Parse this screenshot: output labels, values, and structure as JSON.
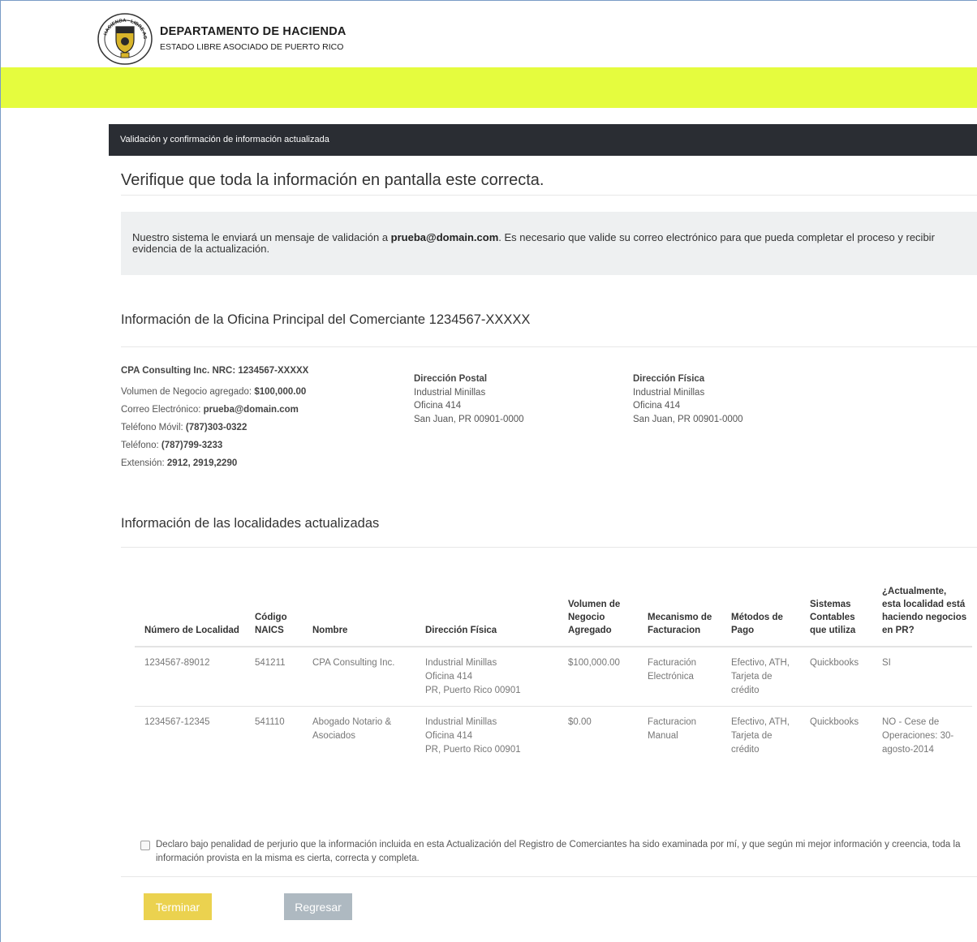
{
  "header": {
    "agency": "DEPARTAMENTO DE HACIENDA",
    "subtitle": "ESTADO LIBRE ASOCIADO DE PUERTO RICO",
    "seal_text": "HACIENDA · LIBRE ASOCIADO DE PUERTO RICO · 1952"
  },
  "section_bar": "Validación y confirmación de información actualizada",
  "page_heading": "Verifique que toda la información en pantalla este correcta.",
  "notice": {
    "before": "Nuestro sistema le enviará un mensaje de validación a ",
    "email": "prueba@domain.com",
    "after": ". Es necesario que valide su correo electrónico para que pueda completar el proceso y recibir evidencia de la actualización."
  },
  "office": {
    "heading": "Información de la Oficina Principal del Comerciante 1234567-XXXXX",
    "company_line": "CPA Consulting Inc. NRC: 1234567-XXXXX",
    "fields": [
      {
        "label": "Volumen de Negocio agregado: ",
        "value": "$100,000.00"
      },
      {
        "label": "Correo Electrónico: ",
        "value": "prueba@domain.com"
      },
      {
        "label": "Teléfono Móvil: ",
        "value": "(787)303-0322"
      },
      {
        "label": "Teléfono: ",
        "value": "(787)799-3233"
      },
      {
        "label": "Extensión: ",
        "value": "2912, 2919,2290"
      }
    ],
    "postal": {
      "title": "Dirección Postal",
      "line1": "Industrial Minillas",
      "line2": "Oficina 414",
      "line3": "San Juan, PR 00901-0000"
    },
    "physical": {
      "title": "Dirección Física",
      "line1": "Industrial Minillas",
      "line2": "Oficina 414",
      "line3": "San Juan, PR 00901-0000"
    }
  },
  "locations": {
    "heading": "Información de las localidades actualizadas",
    "columns": [
      "Número de Localidad",
      "Código NAICS",
      "Nombre",
      "Dirección Física",
      "Volumen de Negocio Agregado",
      "Mecanismo de Facturacion",
      "Métodos de Pago",
      "Sistemas Contables que utiliza",
      "¿Actualmente, esta localidad está haciendo negocios en PR?"
    ],
    "rows": [
      {
        "numero": "1234567-89012",
        "naics": "541211",
        "nombre": "CPA Consulting Inc.",
        "dir1": "Industrial Minillas",
        "dir2": "Oficina 414",
        "dir3": "PR, Puerto Rico 00901",
        "volumen": "$100,000.00",
        "mecanismo": "Facturación Electrónica",
        "pago": "Efectivo, ATH, Tarjeta de crédito",
        "sistemas": "Quickbooks",
        "activo": "SI"
      },
      {
        "numero": "1234567-12345",
        "naics": "541110",
        "nombre": "Abogado Notario & Asociados",
        "dir1": "Industrial Minillas",
        "dir2": "Oficina 414",
        "dir3": "PR, Puerto Rico 00901",
        "volumen": "$0.00",
        "mecanismo": "Facturacion Manual",
        "pago": "Efectivo, ATH, Tarjeta de crédito",
        "sistemas": "Quickbooks",
        "activo": "NO - Cese de Operaciones: 30-agosto-2014"
      }
    ]
  },
  "declaration": "Declaro bajo penalidad de perjurio que la información incluida en esta Actualización del Registro de Comerciantes ha sido examinada por mí, y que según mi mejor información y creencia, toda la información provista en la misma es cierta, correcta y completa.",
  "buttons": {
    "finish": "Terminar",
    "back": "Regresar"
  },
  "colors": {
    "lime": "#e5fc3e",
    "dark_bar": "#2a2d33",
    "finish_button": "#ebd24f",
    "back_button": "#aeb9c1"
  }
}
